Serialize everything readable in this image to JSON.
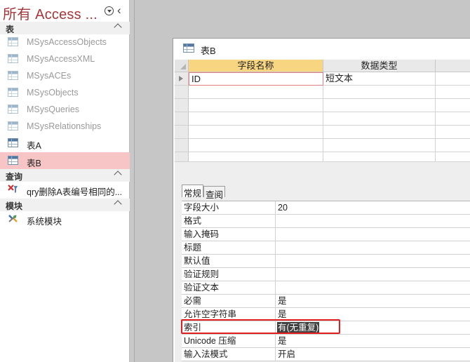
{
  "nav": {
    "title": "所有 Access ...",
    "groups": {
      "tables": "表",
      "queries": "查询",
      "modules": "模块"
    },
    "tables": [
      "MSysAccessObjects",
      "MSysAccessXML",
      "MSysACEs",
      "MSysObjects",
      "MSysQueries",
      "MSysRelationships",
      "表A",
      "表B"
    ],
    "queries": [
      "qry删除A表编号相同的..."
    ],
    "modules": [
      "系统模块"
    ],
    "selected": "表B",
    "icons": {
      "menu": "dropdown-circle-icon",
      "collapse": "chevron-left-icon",
      "table": "table-icon",
      "query": "delete-query-icon",
      "module": "module-icon"
    }
  },
  "document": {
    "title": "表B",
    "columns": {
      "field_name": "字段名称",
      "data_type": "数据类型",
      "description": ""
    },
    "fields": [
      {
        "name": "ID",
        "type": "短文本",
        "description": ""
      }
    ],
    "tabs": {
      "general": "常规",
      "lookup": "查阅"
    },
    "properties": [
      {
        "name": "字段大小",
        "value": "20"
      },
      {
        "name": "格式",
        "value": ""
      },
      {
        "name": "输入掩码",
        "value": ""
      },
      {
        "name": "标题",
        "value": ""
      },
      {
        "name": "默认值",
        "value": ""
      },
      {
        "name": "验证规则",
        "value": ""
      },
      {
        "name": "验证文本",
        "value": ""
      },
      {
        "name": "必需",
        "value": "是"
      },
      {
        "name": "允许空字符串",
        "value": "是"
      },
      {
        "name": "索引",
        "value": "有(无重复)"
      },
      {
        "name": "Unicode 压缩",
        "value": "是"
      },
      {
        "name": "输入法模式",
        "value": "开启"
      }
    ]
  },
  "colors": {
    "title": "#a4373a",
    "selected_item": "#f7c5c5",
    "active_column_header": "#f8d580",
    "highlight_box": "#e02020"
  }
}
